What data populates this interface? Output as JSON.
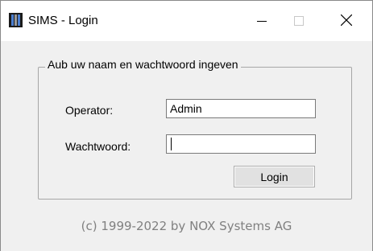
{
  "window": {
    "title": "SIMS - Login",
    "controls": {
      "minimize_icon": "minimize-icon",
      "maximize_icon": "maximize-icon",
      "close_icon": "close-icon"
    }
  },
  "login_form": {
    "group_caption": "Aub uw naam en wachtwoord ingeven",
    "operator_label": "Operator:",
    "operator_value": "Admin",
    "password_label": "Wachtwoord:",
    "password_value": "",
    "login_button": "Login"
  },
  "footer": {
    "copyright": "(c) 1999-2022 by NOX Systems AG"
  },
  "colors": {
    "window_bg": "#f0f0f0",
    "titlebar_bg": "#ffffff",
    "copyright_text": "#808080"
  }
}
